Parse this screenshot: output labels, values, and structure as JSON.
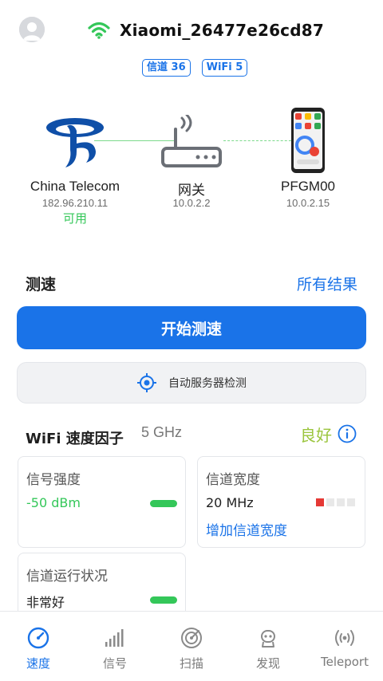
{
  "header": {
    "ssid": "Xiaomi_26477e26cd87",
    "badges": [
      "信道 36",
      "WiFi 5"
    ]
  },
  "topology": {
    "isp": {
      "name": "China Telecom",
      "ip": "182.96.210.11",
      "status": "可用"
    },
    "gateway": {
      "name": "网关",
      "ip": "10.0.2.2"
    },
    "device": {
      "name": "PFGM00",
      "ip": "10.0.2.15"
    }
  },
  "speed_test": {
    "title": "测速",
    "all_results": "所有结果",
    "start_label": "开始测速",
    "auto_server_label": "自动服务器检测"
  },
  "wifi_factors": {
    "title": "WiFi 速度因子",
    "band": "5 GHz",
    "rating": "良好",
    "cards": {
      "signal": {
        "title": "信号强度",
        "value": "-50 dBm"
      },
      "width": {
        "title": "信道宽度",
        "value": "20 MHz",
        "action": "增加信道宽度",
        "level_filled": 1,
        "level_total": 4
      },
      "health": {
        "title": "信道运行状况",
        "value": "非常好"
      }
    }
  },
  "nav": {
    "items": [
      {
        "label": "速度",
        "icon": "speedometer-icon",
        "active": true
      },
      {
        "label": "信号",
        "icon": "signal-bars-icon",
        "active": false
      },
      {
        "label": "扫描",
        "icon": "radar-scan-icon",
        "active": false
      },
      {
        "label": "发现",
        "icon": "discover-robot-icon",
        "active": false
      },
      {
        "label": "Teleport",
        "icon": "teleport-icon",
        "active": false
      }
    ]
  },
  "colors": {
    "accent": "#1a73e8",
    "good": "#34c759",
    "rating": "#9bc53d",
    "warning": "#e53935",
    "telecom_blue": "#0f4fa8"
  }
}
